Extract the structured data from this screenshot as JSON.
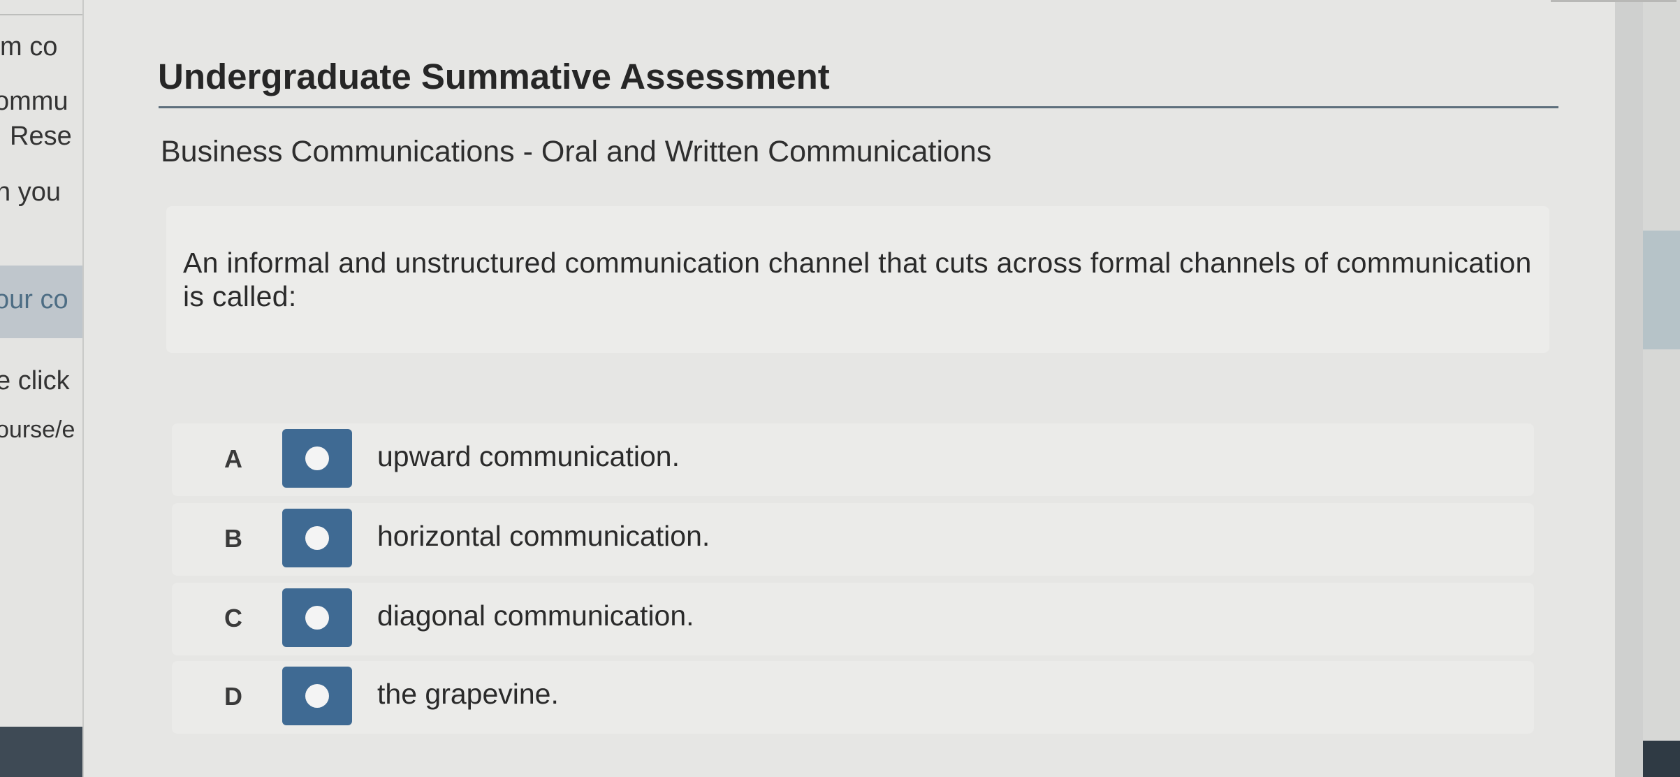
{
  "sidebar": {
    "fragments": [
      "m co",
      "ommu",
      "Rese",
      "n you",
      "our co",
      "e click",
      "ourse/e"
    ]
  },
  "page": {
    "title": "Undergraduate Summative Assessment",
    "subtitle": "Business Communications - Oral and Written Communications"
  },
  "question": {
    "text": "An informal and unstructured communication channel that cuts across formal channels of communication is called:"
  },
  "options": [
    {
      "letter": "A",
      "text": "upward communication."
    },
    {
      "letter": "B",
      "text": "horizontal communication."
    },
    {
      "letter": "C",
      "text": "diagonal communication."
    },
    {
      "letter": "D",
      "text": "the grapevine."
    }
  ],
  "colors": {
    "accent": "#3f6a93",
    "title_rule": "#5e6f7c",
    "panel": "#e6e6e4"
  }
}
